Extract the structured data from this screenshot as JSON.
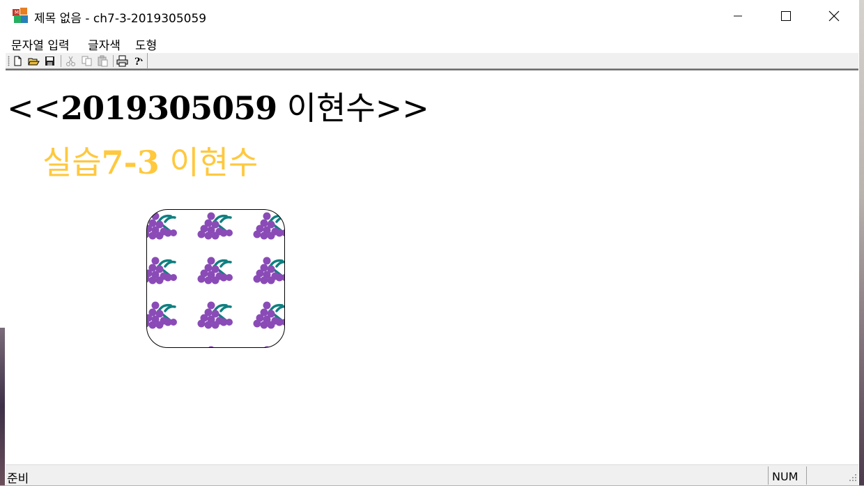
{
  "window": {
    "title": "제목 없음 - ch7-3-2019305059"
  },
  "menu": {
    "items": [
      {
        "label": "문자열 입력"
      },
      {
        "label": "글자색"
      },
      {
        "label": "도형"
      }
    ]
  },
  "toolbar": {
    "buttons": [
      "new-file-icon",
      "open-folder-icon",
      "save-icon",
      "cut-icon",
      "copy-icon",
      "paste-icon",
      "print-icon",
      "help-icon"
    ]
  },
  "content": {
    "heading_prefix": "<<",
    "heading_number": "2019305059",
    "heading_name": " 이현수",
    "heading_suffix": ">>",
    "sub_prefix": "실습",
    "sub_number": "7-3",
    "sub_name": " 이현수",
    "sub_color": "#ffc83d",
    "shape": "rounded-rectangle",
    "shape_fill": "grape-pattern"
  },
  "status": {
    "text": "준비",
    "num_indicator": "NUM"
  }
}
